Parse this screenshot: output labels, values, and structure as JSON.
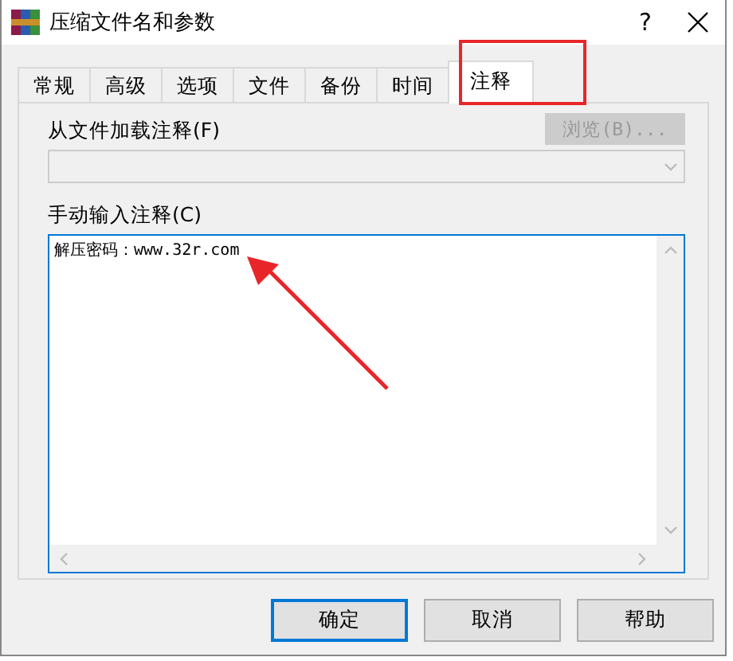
{
  "window": {
    "title": "压缩文件名和参数",
    "help": "?"
  },
  "tabs": [
    {
      "label": "常规",
      "selected": false
    },
    {
      "label": "高级",
      "selected": false
    },
    {
      "label": "选项",
      "selected": false
    },
    {
      "label": "文件",
      "selected": false
    },
    {
      "label": "备份",
      "selected": false
    },
    {
      "label": "时间",
      "selected": false
    },
    {
      "label": "注释",
      "selected": true
    }
  ],
  "load_comment": {
    "label": "从文件加载注释(F)",
    "browse_button": {
      "label": "浏览(B)...",
      "disabled": true
    },
    "file_combo": {
      "disabled": true
    }
  },
  "manual_comment": {
    "label": "手动输入注释(C)",
    "value": "解压密码：www.32r.com"
  },
  "buttons": [
    {
      "label": "确定",
      "default": true
    },
    {
      "label": "取消",
      "default": false
    },
    {
      "label": "帮助",
      "default": false
    }
  ]
}
